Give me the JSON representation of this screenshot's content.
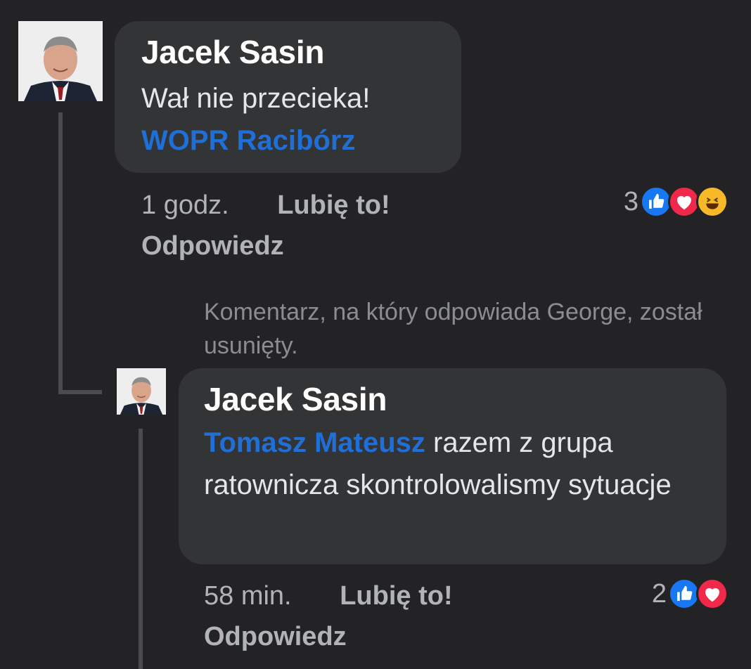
{
  "comment1": {
    "author": "Jacek Sasin",
    "text": "Wał nie przecieka!",
    "mention": "WOPR Racibórz",
    "time": "1 godz.",
    "like_label": "Lubię to!",
    "reply_label": "Odpowiedz",
    "reaction_count": "3",
    "reactions": [
      "like-icon",
      "love-icon",
      "haha-icon"
    ]
  },
  "deleted_note": "Komentarz, na który odpowiada George, został usunięty.",
  "comment2": {
    "author": "Jacek Sasin",
    "mention": "Tomasz Mateusz",
    "text": " razem z grupa ratownicza skontrolowalismy sytuacje",
    "time": "58 min.",
    "like_label": "Lubię to!",
    "reply_label": "Odpowiedz",
    "reaction_count": "2",
    "reactions": [
      "like-icon",
      "love-icon"
    ]
  },
  "colors": {
    "background": "#232325",
    "bubble": "#333436",
    "mention": "#1f6fd6",
    "like": "#1877f2",
    "love": "#f0284a",
    "haha": "#f7b928"
  }
}
